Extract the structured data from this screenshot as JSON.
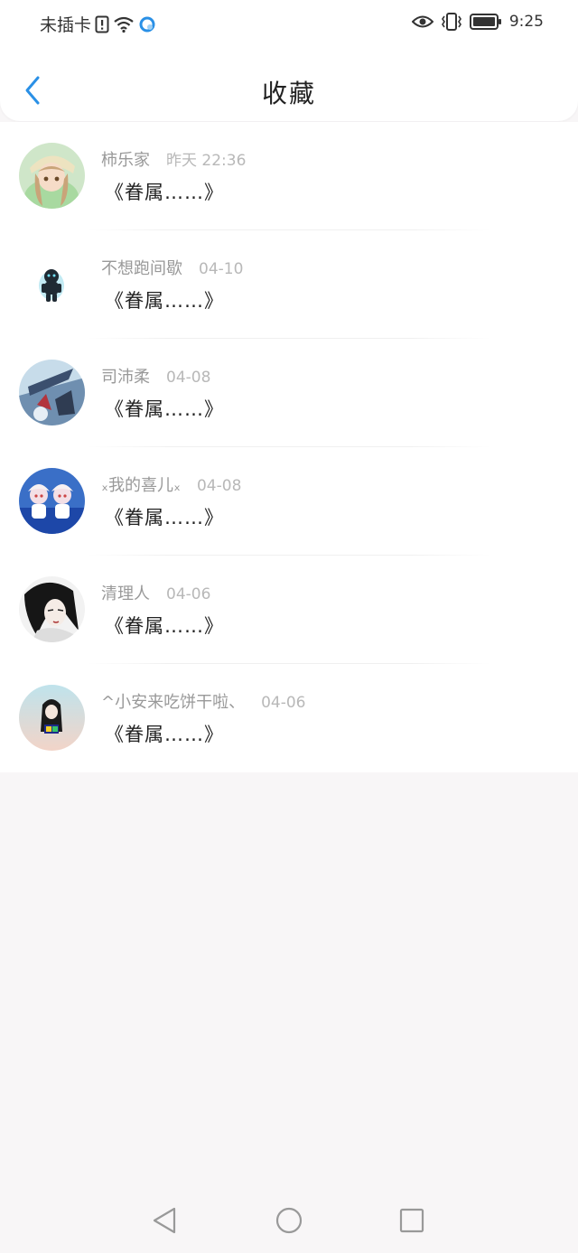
{
  "status_bar": {
    "carrier": "未插卡",
    "time": "9:25",
    "icons": [
      "sim-alert-icon",
      "wifi-icon",
      "sync-icon",
      "eye-icon",
      "vibrate-icon",
      "battery-icon"
    ]
  },
  "header": {
    "title": "收藏",
    "back_icon": "chevron-left-icon"
  },
  "favorites": [
    {
      "name": "柿乐家",
      "time": "昨天 22:36",
      "content": "《眷属……》"
    },
    {
      "name": "不想跑间歇",
      "time": "04-10",
      "content": "《眷属……》"
    },
    {
      "name": "司沛柔",
      "time": "04-08",
      "content": "《眷属……》"
    },
    {
      "name": "ₓ我的喜儿ₓ",
      "time": "04-08",
      "content": "《眷属……》"
    },
    {
      "name": "清理人",
      "time": "04-06",
      "content": "《眷属……》"
    },
    {
      "name": "^小安来吃饼干啦、",
      "time": "04-06",
      "content": "《眷属……》"
    }
  ],
  "colors": {
    "accent": "#2a90e6",
    "background": "#f8f6f7",
    "name_text": "#999999",
    "time_text": "#b8b8b8"
  }
}
